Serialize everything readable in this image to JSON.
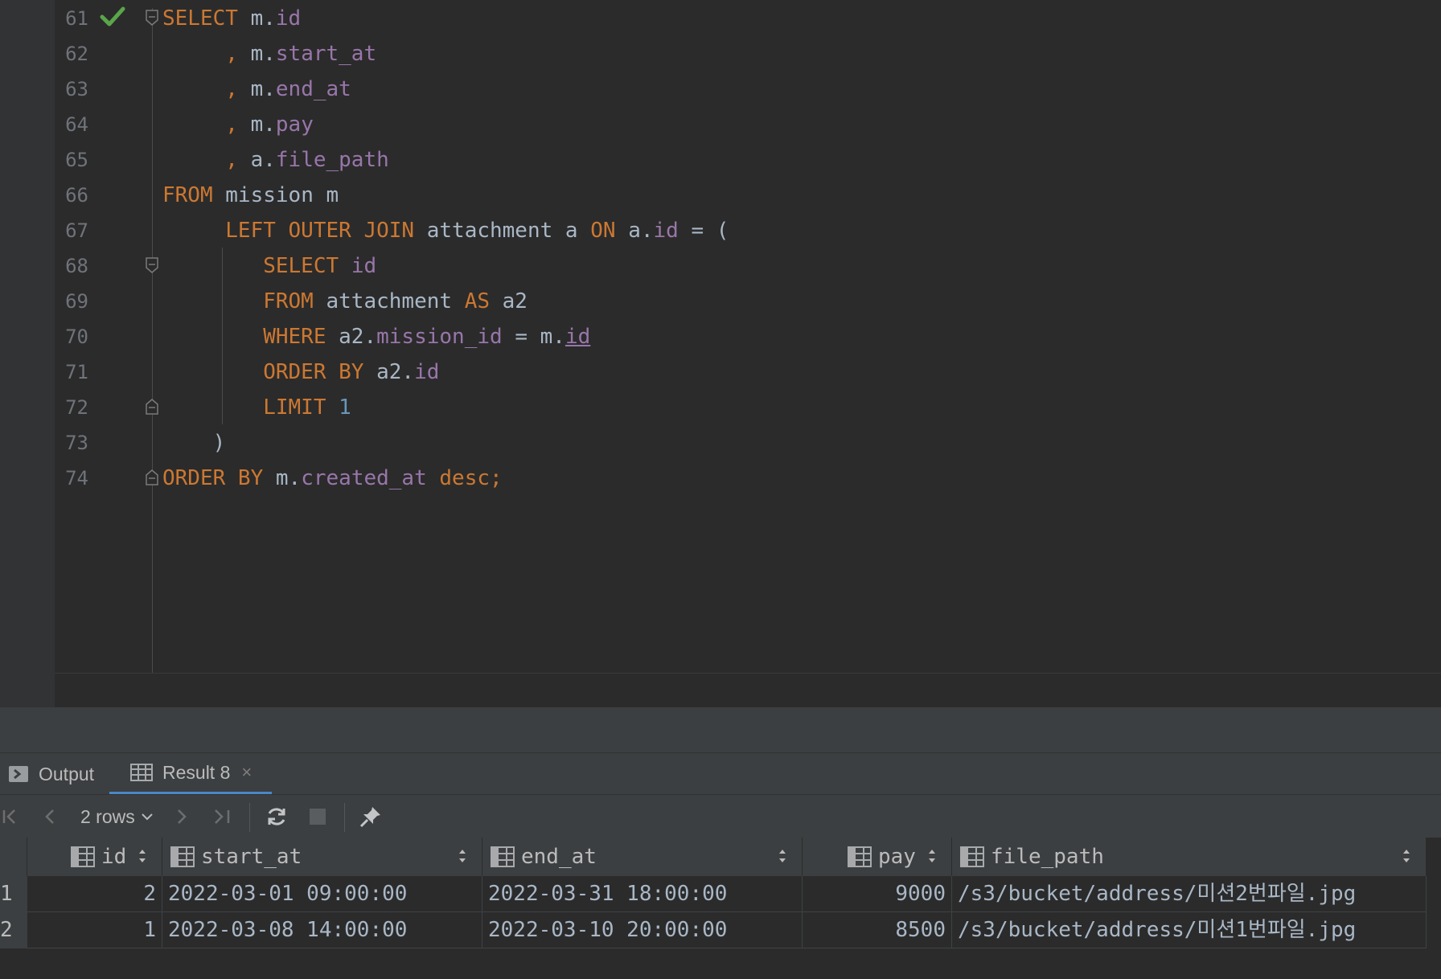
{
  "editor": {
    "lines": [
      {
        "n": "61",
        "k": "l61",
        "tokens": [
          [
            "kw",
            "SELECT"
          ],
          [
            "txt",
            " m."
          ],
          [
            "fld",
            "id"
          ]
        ]
      },
      {
        "n": "62",
        "k": "l62",
        "tokens": [
          [
            "kw",
            "     , "
          ],
          [
            "txt",
            "m."
          ],
          [
            "fld",
            "start_at"
          ]
        ]
      },
      {
        "n": "63",
        "k": "l63",
        "tokens": [
          [
            "kw",
            "     , "
          ],
          [
            "txt",
            "m."
          ],
          [
            "fld",
            "end_at"
          ]
        ]
      },
      {
        "n": "64",
        "k": "l64",
        "tokens": [
          [
            "kw",
            "     , "
          ],
          [
            "txt",
            "m."
          ],
          [
            "fld",
            "pay"
          ]
        ]
      },
      {
        "n": "65",
        "k": "l65",
        "tokens": [
          [
            "kw",
            "     , "
          ],
          [
            "txt",
            "a."
          ],
          [
            "fld",
            "file_path"
          ]
        ]
      },
      {
        "n": "66",
        "k": "l66",
        "tokens": [
          [
            "kw",
            "FROM"
          ],
          [
            "txt",
            " mission m"
          ]
        ]
      },
      {
        "n": "67",
        "k": "l67",
        "tokens": [
          [
            "kw",
            "     LEFT OUTER JOIN"
          ],
          [
            "txt",
            " attachment a "
          ],
          [
            "kw",
            "ON"
          ],
          [
            "txt",
            " a."
          ],
          [
            "fld",
            "id"
          ],
          [
            "txt",
            " = ("
          ]
        ]
      },
      {
        "n": "68",
        "k": "l68",
        "tokens": [
          [
            "kw",
            "        SELECT"
          ],
          [
            "txt",
            " "
          ],
          [
            "fld",
            "id"
          ]
        ]
      },
      {
        "n": "69",
        "k": "l69",
        "tokens": [
          [
            "kw",
            "        FROM"
          ],
          [
            "txt",
            " attachment "
          ],
          [
            "kw",
            "AS"
          ],
          [
            "txt",
            " a2"
          ]
        ]
      },
      {
        "n": "70",
        "k": "l70",
        "tokens": [
          [
            "kw",
            "        WHERE"
          ],
          [
            "txt",
            " a2."
          ],
          [
            "fld",
            "mission_id"
          ],
          [
            "txt",
            " = m."
          ],
          [
            "fldu",
            "id"
          ]
        ]
      },
      {
        "n": "71",
        "k": "l71",
        "tokens": [
          [
            "kw",
            "        ORDER BY"
          ],
          [
            "txt",
            " a2."
          ],
          [
            "fld",
            "id"
          ]
        ]
      },
      {
        "n": "72",
        "k": "l72",
        "tokens": [
          [
            "kw",
            "        LIMIT"
          ],
          [
            "txt",
            " "
          ],
          [
            "num",
            "1"
          ]
        ]
      },
      {
        "n": "73",
        "k": "l73",
        "tokens": [
          [
            "txt",
            "    )"
          ]
        ]
      },
      {
        "n": "74",
        "k": "l74",
        "tokens": [
          [
            "kw",
            "ORDER BY"
          ],
          [
            "txt",
            " m."
          ],
          [
            "fld",
            "created_at"
          ],
          [
            "kw",
            " desc;"
          ]
        ]
      }
    ]
  },
  "tool_window": {
    "tabs": {
      "output": "Output",
      "result": "Result 8",
      "close_glyph": "×"
    },
    "toolbar": {
      "rows_label": "2 rows"
    }
  },
  "grid": {
    "columns": [
      "id",
      "start_at",
      "end_at",
      "pay",
      "file_path"
    ],
    "rows": [
      {
        "row": "1",
        "id": "2",
        "start_at": "2022-03-01 09:00:00",
        "end_at": "2022-03-31 18:00:00",
        "pay": "9000",
        "file_path": "/s3/bucket/address/미션2번파일.jpg"
      },
      {
        "row": "2",
        "id": "1",
        "start_at": "2022-03-08 14:00:00",
        "end_at": "2022-03-10 20:00:00",
        "pay": "8500",
        "file_path": "/s3/bucket/address/미션1번파일.jpg"
      }
    ]
  },
  "colors": {
    "keyword": "#cc7832",
    "field": "#9876aa",
    "number": "#6897bb",
    "text": "#a9b7c6",
    "check": "#5aa54a",
    "accent": "#4a88c7"
  },
  "icons": [
    "check-icon",
    "fold-icon",
    "output-icon",
    "table-icon",
    "close-icon",
    "first-page-icon",
    "prev-page-icon",
    "next-page-icon",
    "last-page-icon",
    "refresh-icon",
    "stop-icon",
    "pin-icon",
    "column-icon",
    "sort-icon"
  ]
}
